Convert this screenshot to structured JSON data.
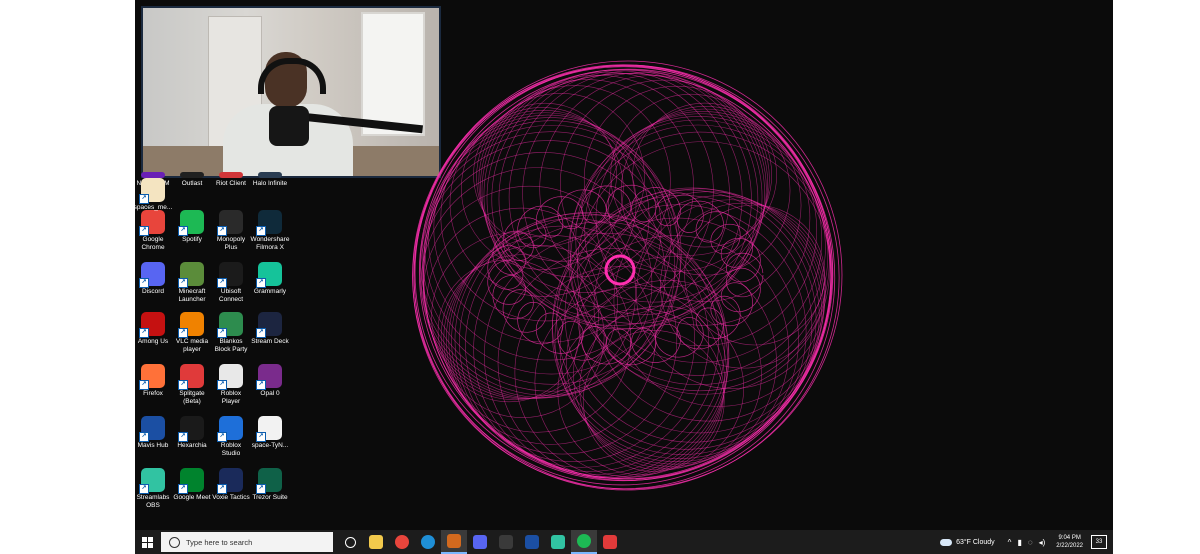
{
  "desktop_icons": [
    {
      "label": "NZXT CAM",
      "icon": "nzxt-cam-icon",
      "color": "#6a1fb6"
    },
    {
      "label": "Outlast",
      "icon": "outlast-icon",
      "color": "#202020"
    },
    {
      "label": "Riot Client",
      "icon": "riot-client-icon",
      "color": "#d13639"
    },
    {
      "label": "Halo Infinite",
      "icon": "halo-infinite-icon",
      "color": "#2a3d52"
    },
    {
      "label": "Google Chrome",
      "icon": "chrome-icon",
      "color": "#e8453c"
    },
    {
      "label": "Spotify",
      "icon": "spotify-icon",
      "color": "#1db954"
    },
    {
      "label": "Monopoly Plus",
      "icon": "monopoly-icon",
      "color": "#2a2a2a"
    },
    {
      "label": "Wondershare Filmora X",
      "icon": "filmora-icon",
      "color": "#0f2a3a"
    },
    {
      "label": "Discord",
      "icon": "discord-icon",
      "color": "#5865f2"
    },
    {
      "label": "Minecraft Launcher",
      "icon": "minecraft-icon",
      "color": "#5b8c3a"
    },
    {
      "label": "Ubisoft Connect",
      "icon": "ubisoft-icon",
      "color": "#1b1b1b"
    },
    {
      "label": "Grammarly",
      "icon": "grammarly-icon",
      "color": "#15c39a"
    },
    {
      "label": "Among Us",
      "icon": "among-us-icon",
      "color": "#c51111"
    },
    {
      "label": "VLC media player",
      "icon": "vlc-icon",
      "color": "#f08200"
    },
    {
      "label": "Blankos Block Party",
      "icon": "blankos-icon",
      "color": "#2d8c4e"
    },
    {
      "label": "Stream Deck",
      "icon": "stream-deck-icon",
      "color": "#1c2540"
    },
    {
      "label": "Firefox",
      "icon": "firefox-icon",
      "color": "#ff7139"
    },
    {
      "label": "Splitgate (Beta)",
      "icon": "splitgate-icon",
      "color": "#e03a3a"
    },
    {
      "label": "Roblox Player",
      "icon": "roblox-player-icon",
      "color": "#e8e8e8"
    },
    {
      "label": "Opal 0",
      "icon": "winrar-icon",
      "color": "#7a2b8c"
    },
    {
      "label": "Mavis Hub",
      "icon": "mavis-hub-icon",
      "color": "#1b4fa3"
    },
    {
      "label": "Hexarchia",
      "icon": "hexarchia-icon",
      "color": "#1a1a1a"
    },
    {
      "label": "Roblox Studio",
      "icon": "roblox-studio-icon",
      "color": "#1e6fd9"
    },
    {
      "label": "space-TyN...",
      "icon": "file-icon",
      "color": "#f2f2f2"
    },
    {
      "label": "Streamlabs OBS",
      "icon": "streamlabs-icon",
      "color": "#31c3a2"
    },
    {
      "label": "Google Meet",
      "icon": "google-meet-icon",
      "color": "#00832d"
    },
    {
      "label": "Voxie Tactics",
      "icon": "voxie-tactics-icon",
      "color": "#1a2a5a"
    },
    {
      "label": "Trezor Suite",
      "icon": "trezor-icon",
      "color": "#0f6148"
    },
    {
      "label": "spaces_me...",
      "icon": "document-icon",
      "color": "#f4e4c1"
    }
  ],
  "taskbar": {
    "search_placeholder": "Type here to search",
    "apps": [
      {
        "icon": "task-view-icon",
        "color": "#1c1c1c"
      },
      {
        "icon": "file-explorer-icon",
        "color": "#f2c94c"
      },
      {
        "icon": "chrome-icon",
        "color": "#e8453c"
      },
      {
        "icon": "edge-icon",
        "color": "#1f8fd6"
      },
      {
        "icon": "app-icon",
        "color": "#d2691e"
      },
      {
        "icon": "discord-icon",
        "color": "#5865f2"
      },
      {
        "icon": "terminal-icon",
        "color": "#3a3a3a"
      },
      {
        "icon": "mavis-hub-icon",
        "color": "#1b4fa3"
      },
      {
        "icon": "streamlabs-icon",
        "color": "#31c3a2"
      },
      {
        "icon": "spotify-icon",
        "color": "#1db954"
      },
      {
        "icon": "app-red-icon",
        "color": "#e03a3a"
      }
    ],
    "weather": "63°F  Cloudy",
    "time": "9:04 PM",
    "date": "2/22/2022",
    "notifications": "33"
  },
  "colors": {
    "spiral": "#ff2fb0",
    "desktop_bg": "#0b0b0b",
    "taskbar_bg": "#1c1c1c"
  }
}
